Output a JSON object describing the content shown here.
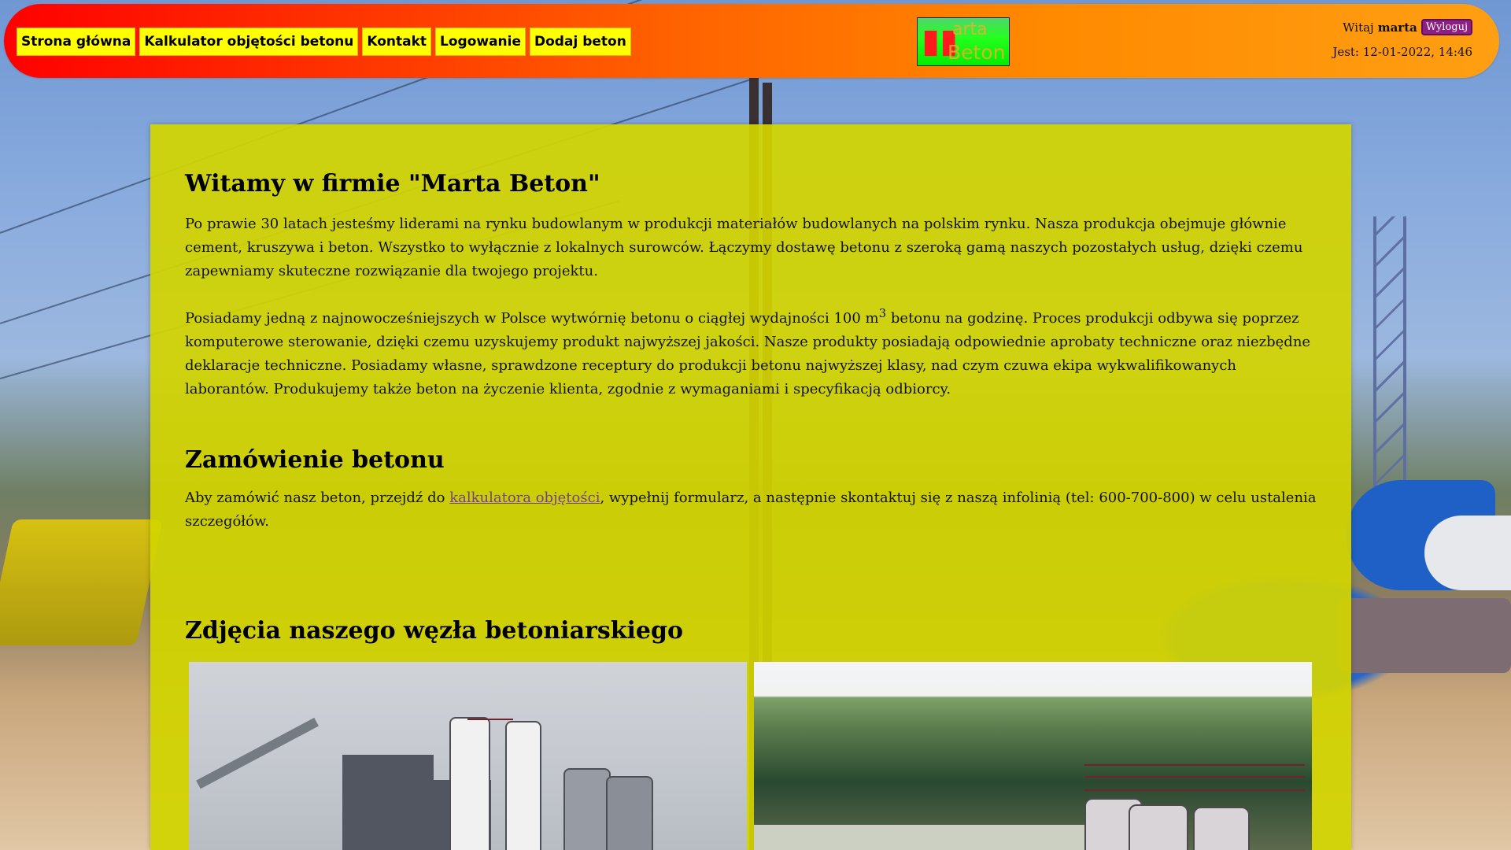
{
  "header": {
    "nav": [
      "Strona główna",
      "Kalkulator objętości betonu",
      "Kontakt",
      "Logowanie",
      "Dodaj beton"
    ],
    "logo": {
      "line1": "arta",
      "line2": "Beton"
    },
    "user": {
      "greeting": "Witaj",
      "name": "marta",
      "logout": "Wyloguj",
      "datetime": "Jest: 12-01-2022, 14:46"
    }
  },
  "content": {
    "title": "Witamy w firmie \"Marta Beton\"",
    "intro1": "Po prawie 30 latach jesteśmy liderami na rynku budowlanym w produkcji materiałów budowlanych na polskim rynku. Nasza produkcja obejmuje głównie cement, kruszywa i beton. Wszystko to wyłącznie z lokalnych surowców. Łączymy dostawę betonu z szeroką gamą naszych pozostałych usług, dzięki czemu zapewniamy skuteczne rozwiązanie dla twojego projektu.",
    "intro2_before": "Posiadamy jedną z najnowocześniejszych w Polsce wytwórnię betonu o ciągłej wydajności 100 m",
    "intro2_superscript": "3",
    "intro2_after": " betonu na godzinę. Proces produkcji odbywa się poprzez komputerowe sterowanie, dzięki czemu uzyskujemy produkt najwyższej jakości. Nasze produkty posiadają odpowiednie aprobaty techniczne oraz niezbędne deklaracje techniczne. Posiadamy własne, sprawdzone receptury do produkcji betonu najwyższej klasy, nad czym czuwa ekipa wykwalifikowanych laborantów. Produkujemy także beton na życzenie klienta, zgodnie z wymaganiami i specyfikacją odbiorcy.",
    "section2_title": "Zamówienie betonu",
    "order_before": "Aby zamówić nasz beton, przejdź do ",
    "order_link": "kalkulatora objętości",
    "order_after": ", wypełnij formularz, a następnie skontaktuj się z naszą infolinią (tel: 600-700-800) w celu ustalenia szczegółów.",
    "section3_title": "Zdjęcia naszego węzła betoniarskiego"
  },
  "colors": {
    "header_start": "#ff0000",
    "header_end": "#ff9f12",
    "nav_bg": "#ffff00",
    "content_bg": "#d2d400",
    "logout_bg": "#8d1f84",
    "link": "#743f8f"
  },
  "icons": {
    "logo_mark": "red-bars-logo-mark"
  }
}
